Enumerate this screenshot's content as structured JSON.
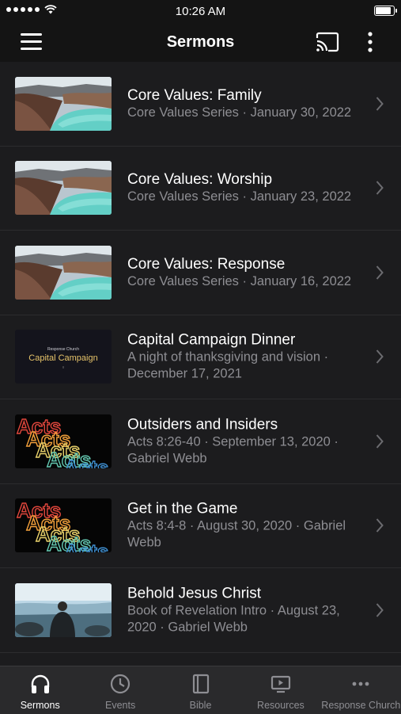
{
  "status": {
    "time": "10:26 AM"
  },
  "header": {
    "title": "Sermons"
  },
  "sermons": [
    {
      "title": "Core Values: Family",
      "subtitle": "Core Values Series · January 30, 2022",
      "thumb": "landscape"
    },
    {
      "title": "Core Values: Worship",
      "subtitle": "Core Values Series · January 23, 2022",
      "thumb": "landscape"
    },
    {
      "title": "Core Values: Response",
      "subtitle": "Core Values Series · January 16, 2022",
      "thumb": "landscape"
    },
    {
      "title": "Capital Campaign Dinner",
      "subtitle": "A night of thanksgiving and vision · December 17, 2021",
      "thumb": "campaign",
      "thumb_small": "Response Church",
      "thumb_text": "Capital Campaign"
    },
    {
      "title": "Outsiders and Insiders",
      "subtitle": "Acts 8:26-40 · September 13, 2020 · Gabriel Webb",
      "thumb": "acts",
      "thumb_text": "Acts"
    },
    {
      "title": "Get in the Game",
      "subtitle": "Acts 8:4-8 · August 30, 2020 · Gabriel Webb",
      "thumb": "acts",
      "thumb_text": "Acts"
    },
    {
      "title": "Behold Jesus Christ",
      "subtitle": "Book of Revelation Intro · August 23, 2020 · Gabriel Webb",
      "thumb": "person"
    }
  ],
  "tabs": [
    {
      "label": "Sermons",
      "icon": "headphones-icon",
      "active": true
    },
    {
      "label": "Events",
      "icon": "clock-icon",
      "active": false
    },
    {
      "label": "Bible",
      "icon": "book-icon",
      "active": false
    },
    {
      "label": "Resources",
      "icon": "tv-play-icon",
      "active": false
    },
    {
      "label": "Response Church",
      "icon": "more-horizontal-icon",
      "active": false
    }
  ],
  "colors": {
    "background": "#1c1c1e",
    "bars": "#141414",
    "secondary_text": "#8e8e93",
    "tab_bar": "#2a2a2c"
  }
}
